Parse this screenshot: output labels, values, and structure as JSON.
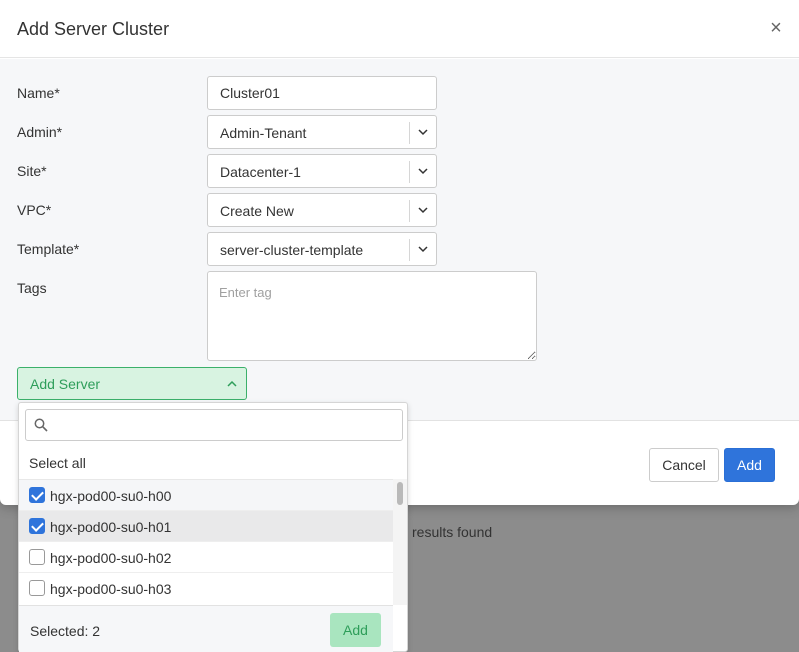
{
  "background": {
    "results_text": "results found"
  },
  "modal": {
    "title": "Add Server Cluster",
    "close_symbol": "×"
  },
  "form": {
    "name": {
      "label": "Name*",
      "value": "Cluster01"
    },
    "admin": {
      "label": "Admin*",
      "value": "Admin-Tenant"
    },
    "site": {
      "label": "Site*",
      "value": "Datacenter-1"
    },
    "vpc": {
      "label": "VPC*",
      "value": "Create New"
    },
    "template": {
      "label": "Template*",
      "value": "server-cluster-template"
    },
    "tags": {
      "label": "Tags",
      "placeholder": "Enter tag"
    }
  },
  "add_server": {
    "label": "Add Server",
    "dropdown": {
      "search_placeholder": "",
      "select_all": "Select all",
      "items": [
        {
          "label": "hgx-pod00-su0-h00",
          "checked": true
        },
        {
          "label": "hgx-pod00-su0-h01",
          "checked": true
        },
        {
          "label": "hgx-pod00-su0-h02",
          "checked": false
        },
        {
          "label": "hgx-pod00-su0-h03",
          "checked": false
        }
      ],
      "selected_text": "Selected: 2",
      "add_label": "Add"
    }
  },
  "footer": {
    "cancel_label": "Cancel",
    "add_label": "Add"
  },
  "colors": {
    "primary": "#2f74db",
    "success": "#3bb06a",
    "success_bg": "#d8f3e1"
  }
}
